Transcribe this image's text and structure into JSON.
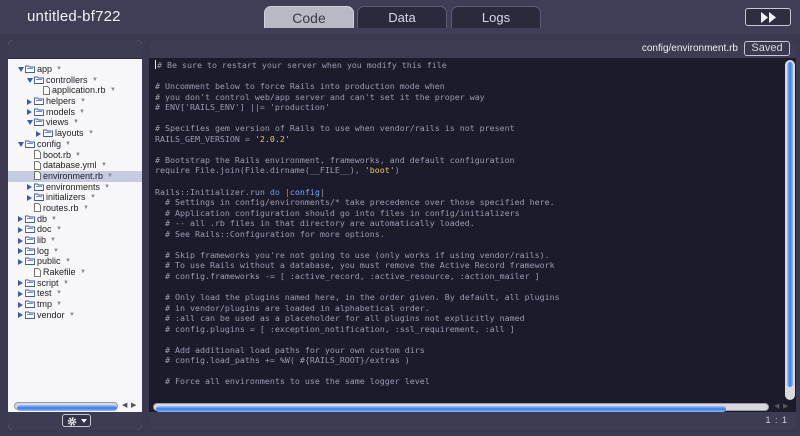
{
  "app": {
    "title": "untitled-bf722"
  },
  "tabs": [
    {
      "label": "Code",
      "active": true
    },
    {
      "label": "Data",
      "active": false
    },
    {
      "label": "Logs",
      "active": false
    }
  ],
  "toolbar": {
    "run_icon": "fast-forward-icon"
  },
  "file_tree": [
    {
      "label": "app",
      "kind": "folder",
      "depth": 0,
      "expanded": true,
      "menu": true
    },
    {
      "label": "controllers",
      "kind": "folder",
      "depth": 1,
      "expanded": true,
      "menu": true
    },
    {
      "label": "application.rb",
      "kind": "file",
      "depth": 2,
      "menu": true
    },
    {
      "label": "helpers",
      "kind": "folder",
      "depth": 1,
      "expanded": false,
      "menu": true
    },
    {
      "label": "models",
      "kind": "folder",
      "depth": 1,
      "expanded": false,
      "menu": true
    },
    {
      "label": "views",
      "kind": "folder",
      "depth": 1,
      "expanded": true,
      "menu": true
    },
    {
      "label": "layouts",
      "kind": "folder",
      "depth": 2,
      "expanded": false,
      "menu": true
    },
    {
      "label": "config",
      "kind": "folder",
      "depth": 0,
      "expanded": true,
      "menu": true
    },
    {
      "label": "boot.rb",
      "kind": "file",
      "depth": 1,
      "menu": true
    },
    {
      "label": "database.yml",
      "kind": "file",
      "depth": 1,
      "menu": true
    },
    {
      "label": "environment.rb",
      "kind": "file",
      "depth": 1,
      "menu": true,
      "selected": true
    },
    {
      "label": "environments",
      "kind": "folder",
      "depth": 1,
      "expanded": false,
      "menu": true
    },
    {
      "label": "initializers",
      "kind": "folder",
      "depth": 1,
      "expanded": false,
      "menu": true
    },
    {
      "label": "routes.rb",
      "kind": "file",
      "depth": 1,
      "menu": true
    },
    {
      "label": "db",
      "kind": "folder",
      "depth": 0,
      "expanded": false,
      "menu": true
    },
    {
      "label": "doc",
      "kind": "folder",
      "depth": 0,
      "expanded": false,
      "menu": true
    },
    {
      "label": "lib",
      "kind": "folder",
      "depth": 0,
      "expanded": false,
      "menu": true
    },
    {
      "label": "log",
      "kind": "folder",
      "depth": 0,
      "expanded": false,
      "menu": true
    },
    {
      "label": "public",
      "kind": "folder",
      "depth": 0,
      "expanded": false,
      "menu": true
    },
    {
      "label": "Rakefile",
      "kind": "file",
      "depth": 1,
      "menu": true
    },
    {
      "label": "script",
      "kind": "folder",
      "depth": 0,
      "expanded": false,
      "menu": true
    },
    {
      "label": "test",
      "kind": "folder",
      "depth": 0,
      "expanded": false,
      "menu": true
    },
    {
      "label": "tmp",
      "kind": "folder",
      "depth": 0,
      "expanded": false,
      "menu": true
    },
    {
      "label": "vendor",
      "kind": "folder",
      "depth": 0,
      "expanded": false,
      "menu": true
    }
  ],
  "left_footer": {
    "settings_icon": "gear-icon",
    "menu_icon": "chevron-down-icon"
  },
  "editor": {
    "file_path": "config/environment.rb",
    "save_status": "Saved",
    "cursor_position": "1 : 1",
    "lines": [
      {
        "segments": [
          {
            "t": "# Be sure to restart your server when you modify this file",
            "c": "cmt"
          }
        ],
        "cursor": true
      },
      {
        "segments": []
      },
      {
        "segments": [
          {
            "t": "# Uncomment below to force Rails into production mode when",
            "c": "cmt"
          }
        ]
      },
      {
        "segments": [
          {
            "t": "# you don't control web/app server and can't set it the proper way",
            "c": "cmt"
          }
        ]
      },
      {
        "segments": [
          {
            "t": "# ENV['RAILS_ENV'] ||= 'production'",
            "c": "cmt"
          }
        ]
      },
      {
        "segments": []
      },
      {
        "segments": [
          {
            "t": "# Specifies gem version of Rails to use when vendor/rails is not present",
            "c": "cmt"
          }
        ]
      },
      {
        "segments": [
          {
            "t": "RAILS_GEM_VERSION = ",
            "c": "code"
          },
          {
            "t": "'2.0.2'",
            "c": "str"
          }
        ]
      },
      {
        "segments": []
      },
      {
        "segments": [
          {
            "t": "# Bootstrap the Rails environment, frameworks, and default configuration",
            "c": "cmt"
          }
        ]
      },
      {
        "segments": [
          {
            "t": "require File.join(File.dirname(__FILE__), ",
            "c": "code"
          },
          {
            "t": "'boot'",
            "c": "str"
          },
          {
            "t": ")",
            "c": "code"
          }
        ]
      },
      {
        "segments": []
      },
      {
        "segments": [
          {
            "t": "Rails::Initializer.run ",
            "c": "code"
          },
          {
            "t": "do",
            "c": "kw"
          },
          {
            "t": " |",
            "c": "code"
          },
          {
            "t": "config",
            "c": "sym"
          },
          {
            "t": "|",
            "c": "code"
          }
        ]
      },
      {
        "segments": [
          {
            "t": "  # Settings in config/environments/* take precedence over those specified here.",
            "c": "cmt"
          }
        ]
      },
      {
        "segments": [
          {
            "t": "  # Application configuration should go into files in config/initializers",
            "c": "cmt"
          }
        ]
      },
      {
        "segments": [
          {
            "t": "  # -- all .rb files in that directory are automatically loaded.",
            "c": "cmt"
          }
        ]
      },
      {
        "segments": [
          {
            "t": "  # See Rails::Configuration for more options.",
            "c": "cmt"
          }
        ]
      },
      {
        "segments": []
      },
      {
        "segments": [
          {
            "t": "  # Skip frameworks you're not going to use (only works if using vendor/rails).",
            "c": "cmt"
          }
        ]
      },
      {
        "segments": [
          {
            "t": "  # To use Rails without a database, you must remove the Active Record framework",
            "c": "cmt"
          }
        ]
      },
      {
        "segments": [
          {
            "t": "  # config.frameworks -= [ :active_record, :active_resource, :action_mailer ]",
            "c": "cmt"
          }
        ]
      },
      {
        "segments": []
      },
      {
        "segments": [
          {
            "t": "  # Only load the plugins named here, in the order given. By default, all plugins",
            "c": "cmt"
          }
        ]
      },
      {
        "segments": [
          {
            "t": "  # in vendor/plugins are loaded in alphabetical order.",
            "c": "cmt"
          }
        ]
      },
      {
        "segments": [
          {
            "t": "  # :all can be used as a placeholder for all plugins not explicitly named",
            "c": "cmt"
          }
        ]
      },
      {
        "segments": [
          {
            "t": "  # config.plugins = [ :exception_notification, :ssl_requirement, :all ]",
            "c": "cmt"
          }
        ]
      },
      {
        "segments": []
      },
      {
        "segments": [
          {
            "t": "  # Add additional load paths for your own custom dirs",
            "c": "cmt"
          }
        ]
      },
      {
        "segments": [
          {
            "t": "  # config.load_paths += %W( #{RAILS_ROOT}/extras )",
            "c": "cmt"
          }
        ]
      },
      {
        "segments": []
      },
      {
        "segments": [
          {
            "t": "  # Force all environments to use the same logger level",
            "c": "cmt"
          }
        ]
      }
    ]
  },
  "colors": {
    "background": "#3a3950",
    "editor_bg": "#1c1b2b",
    "string": "#e8c860",
    "keyword": "#6a9be0",
    "scroll_thumb": "#3d7be0"
  }
}
